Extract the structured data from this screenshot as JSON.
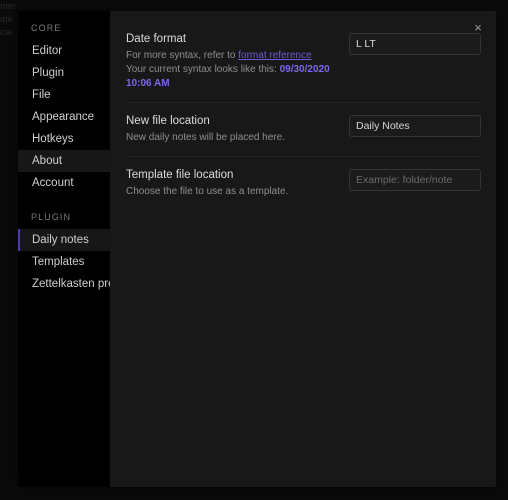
{
  "background_hints": {
    "line1": "nter",
    "line2": "ate",
    "line3": "cat"
  },
  "modal": {
    "close_icon": "×"
  },
  "sidebar": {
    "sections": [
      {
        "header": "CORE",
        "items": [
          {
            "label": "Editor",
            "state": "normal"
          },
          {
            "label": "Plugin",
            "state": "normal"
          },
          {
            "label": "File",
            "state": "normal"
          },
          {
            "label": "Appearance",
            "state": "normal"
          },
          {
            "label": "Hotkeys",
            "state": "normal"
          },
          {
            "label": "About",
            "state": "hovered"
          },
          {
            "label": "Account",
            "state": "normal"
          }
        ]
      },
      {
        "header": "PLUGIN",
        "items": [
          {
            "label": "Daily notes",
            "state": "active"
          },
          {
            "label": "Templates",
            "state": "normal"
          },
          {
            "label": "Zettelkasten prefixer",
            "state": "normal"
          }
        ]
      }
    ]
  },
  "settings": {
    "date_format": {
      "name": "Date format",
      "desc_prefix": "For more syntax, refer to ",
      "link_label": "format reference",
      "syntax_label": "Your current syntax looks like this: ",
      "syntax_value": "09/30/2020 10:06 AM",
      "input_value": "L LT",
      "input_placeholder": ""
    },
    "new_file_location": {
      "name": "New file location",
      "desc": "New daily notes will be placed here.",
      "input_value": "Daily Notes",
      "input_placeholder": ""
    },
    "template_file_location": {
      "name": "Template file location",
      "desc": "Choose the file to use as a template.",
      "input_value": "",
      "input_placeholder": "Example: folder/note"
    }
  }
}
